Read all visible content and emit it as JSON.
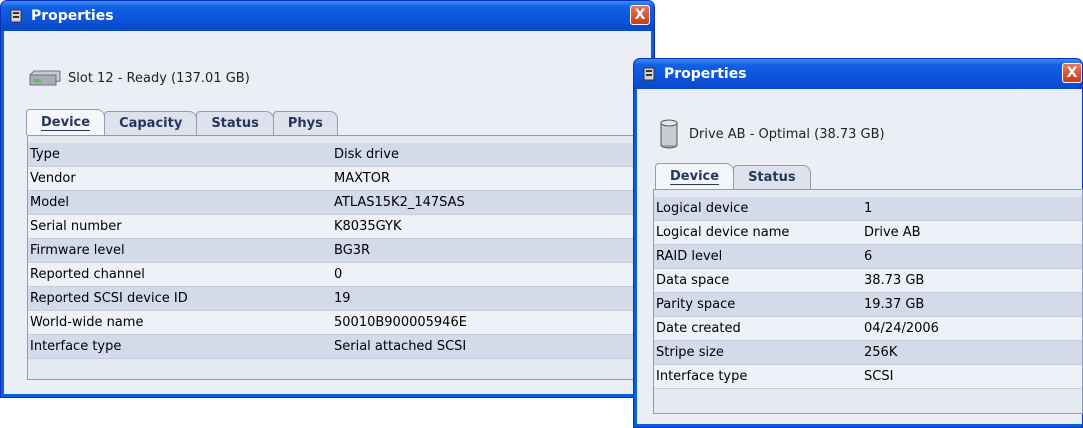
{
  "left_window": {
    "title": "Properties",
    "close_label": "X",
    "header_text": "Slot 12 - Ready (137.01 GB)",
    "header_icon": "hard-drive-icon",
    "tabs": [
      "Device",
      "Capacity",
      "Status",
      "Phys"
    ],
    "active_tab": "Device",
    "rows": [
      {
        "label": "Type",
        "value": "Disk drive"
      },
      {
        "label": "Vendor",
        "value": "MAXTOR"
      },
      {
        "label": "Model",
        "value": "ATLAS15K2_147SAS"
      },
      {
        "label": "Serial number",
        "value": "K8035GYK"
      },
      {
        "label": "Firmware level",
        "value": "BG3R"
      },
      {
        "label": "Reported channel",
        "value": "0"
      },
      {
        "label": "Reported SCSI device ID",
        "value": "19"
      },
      {
        "label": "World-wide name",
        "value": "50010B900005946E"
      },
      {
        "label": "Interface type",
        "value": "Serial attached SCSI"
      }
    ]
  },
  "right_window": {
    "title": "Properties",
    "close_label": "X",
    "header_text": "Drive AB - Optimal (38.73 GB)",
    "header_icon": "cylinder-drive-icon",
    "tabs": [
      "Device",
      "Status"
    ],
    "active_tab": "Device",
    "rows": [
      {
        "label": "Logical device",
        "value": "1"
      },
      {
        "label": "Logical device name",
        "value": "Drive AB"
      },
      {
        "label": "RAID level",
        "value": "6"
      },
      {
        "label": "Data space",
        "value": "38.73 GB"
      },
      {
        "label": "Parity space",
        "value": "19.37 GB"
      },
      {
        "label": "Date created",
        "value": "04/24/2006"
      },
      {
        "label": "Stripe size",
        "value": "256K"
      },
      {
        "label": "Interface type",
        "value": "SCSI"
      }
    ]
  },
  "colors": {
    "title_bar": "#0b52d6",
    "client_bg": "#ebeef5",
    "close_button": "#d4481f"
  }
}
